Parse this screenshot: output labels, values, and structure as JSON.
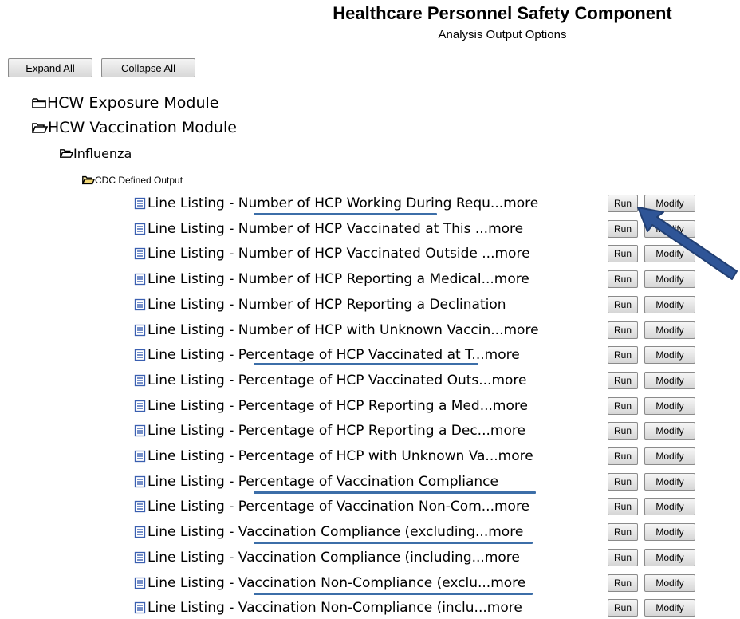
{
  "header": {
    "title": "Healthcare Personnel Safety Component",
    "subtitle": "Analysis Output Options"
  },
  "toolbar": {
    "expand_all": "Expand All",
    "collapse_all": "Collapse All"
  },
  "tree": {
    "exposure_module": "HCW Exposure Module",
    "vaccination_module": "HCW Vaccination Module",
    "influenza": "Influenza",
    "cdc_defined_output": "CDC Defined Output"
  },
  "buttons": {
    "run": "Run",
    "modify": "Modify"
  },
  "items": [
    {
      "label": "Line Listing - Number of HCP Working During Requ...more"
    },
    {
      "label": "Line Listing - Number of HCP Vaccinated at This ...more"
    },
    {
      "label": "Line Listing - Number of HCP Vaccinated Outside ...more"
    },
    {
      "label": "Line Listing - Number of HCP Reporting a Medical...more"
    },
    {
      "label": "Line Listing - Number of HCP Reporting a Declination"
    },
    {
      "label": "Line Listing - Number of HCP with Unknown Vaccin...more"
    },
    {
      "label": "Line Listing - Percentage of HCP Vaccinated at T...more"
    },
    {
      "label": "Line Listing - Percentage of HCP Vaccinated Outs...more"
    },
    {
      "label": "Line Listing - Percentage of HCP Reporting a Med...more"
    },
    {
      "label": "Line Listing - Percentage of HCP Reporting a Dec...more"
    },
    {
      "label": "Line Listing - Percentage of HCP with Unknown Va...more"
    },
    {
      "label": "Line Listing - Percentage of Vaccination Compliance"
    },
    {
      "label": "Line Listing - Percentage of Vaccination Non-Com...more"
    },
    {
      "label": "Line Listing - Vaccination Compliance (excluding...more"
    },
    {
      "label": "Line Listing - Vaccination Compliance (including...more"
    },
    {
      "label": "Line Listing - Vaccination Non-Compliance (exclu...more"
    },
    {
      "label": "Line Listing - Vaccination Non-Compliance (inclu...more"
    }
  ],
  "colors": {
    "annotation": "#3c6ea8",
    "doc_icon": "#3a5fb0"
  }
}
